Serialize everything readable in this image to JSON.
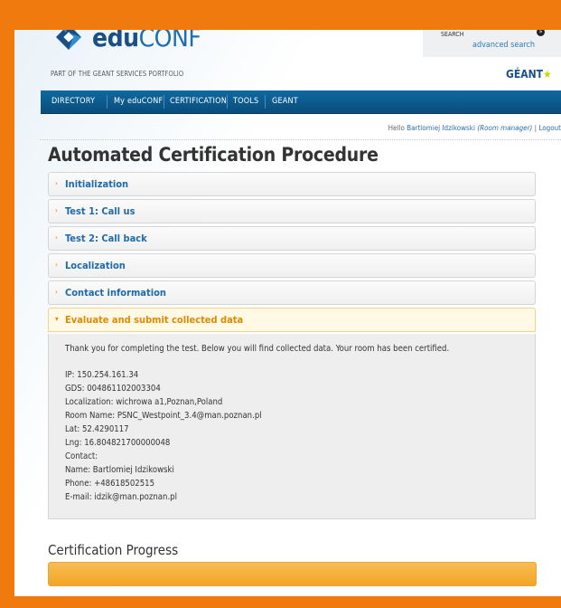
{
  "header": {
    "logo_main": "edu",
    "logo_accent": "CONF",
    "tagline": "PART OF THE GEANT SERVICES PORTFOLIO",
    "search_label": "SEARCH",
    "search_go": "»",
    "advanced_search": "advanced search",
    "geant_text": "GÉANT",
    "geant_star": "★"
  },
  "nav": {
    "items": [
      "DIRECTORY",
      "My eduCONF",
      "CERTIFICATION",
      "TOOLS",
      "GEANT"
    ]
  },
  "user": {
    "hello": "Hello",
    "name": "Bartlomiej Idzikowski",
    "role": "(Room manager)",
    "sep": "|",
    "logout": "Logout"
  },
  "page": {
    "title": "Automated Certification Procedure",
    "progress_title": "Certification Progress"
  },
  "accordion": {
    "items": [
      {
        "label": "Initialization",
        "arrow": "›"
      },
      {
        "label": "Test 1: Call us",
        "arrow": "›"
      },
      {
        "label": "Test 2: Call back",
        "arrow": "›"
      },
      {
        "label": "Localization",
        "arrow": "›"
      },
      {
        "label": "Contact information",
        "arrow": "›"
      },
      {
        "label": "Evaluate and submit collected data",
        "arrow": "▾"
      }
    ],
    "panel": {
      "intro": "Thank you for completing the test. Below you will find collected data. Your room has been certified.",
      "lines": [
        "IP: 150.254.161.34",
        "GDS: 004861102003304",
        "Localization: wichrowa a1,Poznan,Poland",
        "Room Name: PSNC_Westpoint_3.4@man.poznan.pl",
        "Lat: 52.4290117",
        "Lng: 16.804821700000048",
        "Contact:",
        "Name: Bartlomiej Idzikowski",
        "Phone: +48618502515",
        "E-mail: idzik@man.poznan.pl"
      ]
    }
  },
  "colors": {
    "frame": "#f07a0e",
    "nav": "#0a4c7c",
    "link": "#1e6aab",
    "active": "#e08a00",
    "progress": "#f2a524"
  }
}
